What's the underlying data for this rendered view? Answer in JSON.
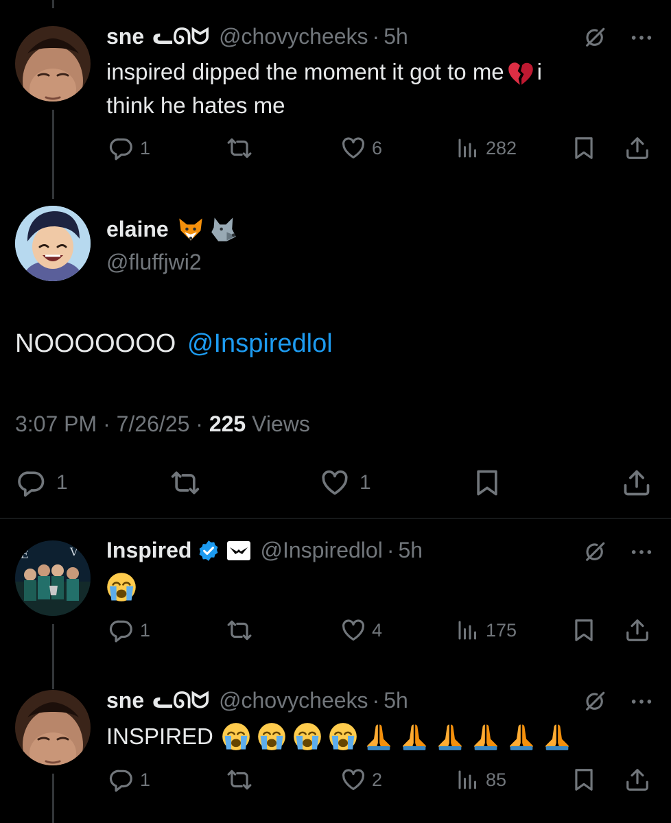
{
  "tweet1": {
    "name": "sne",
    "handle": "@chovycheeks",
    "time": "5h",
    "text_a": "inspired dipped the moment it got to me",
    "text_b": "i",
    "text_c": "think he hates me",
    "replies": "1",
    "likes": "6",
    "views": "282"
  },
  "main": {
    "name": "elaine",
    "handle": "@fluffjwi2",
    "text": "NOOOOOOO",
    "mention": "@Inspiredlol",
    "time": "3:07 PM",
    "date": "7/26/25",
    "views_count": "225",
    "views_label": "Views",
    "replies": "1",
    "likes": "1"
  },
  "tweet2": {
    "name": "Inspired",
    "handle": "@Inspiredlol",
    "time": "5h",
    "replies": "1",
    "likes": "4",
    "views": "175"
  },
  "tweet3": {
    "name": "sne",
    "handle": "@chovycheeks",
    "time": "5h",
    "text": "INSPIRED",
    "replies": "1",
    "likes": "2",
    "views": "85"
  },
  "colors": {
    "background": "#000000",
    "text": "#e7e9ea",
    "muted": "#71767b",
    "link": "#1d9bf0",
    "verified": "#1d9bf0"
  },
  "icons": [
    "reply-icon",
    "retweet-icon",
    "like-icon",
    "views-icon",
    "bookmark-icon",
    "share-icon",
    "grok-icon",
    "more-icon",
    "verified-badge-icon",
    "broken-heart-emoji",
    "sob-emoji",
    "pray-emoji",
    "fox-emoji",
    "wolf-emoji"
  ]
}
